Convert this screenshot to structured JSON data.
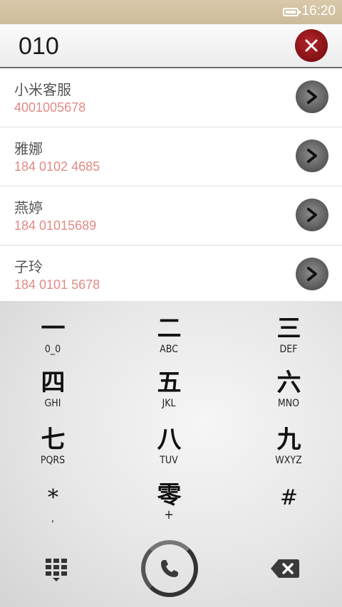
{
  "status_bar": {
    "time": "16:20",
    "battery_icon": "battery-icon"
  },
  "dial_input": {
    "value": "010",
    "clear_icon": "close-icon"
  },
  "results": [
    {
      "name": "小米客服",
      "number": "4001005678"
    },
    {
      "name": "雅娜",
      "number": "184 0102 4685"
    },
    {
      "name": "燕婷",
      "number": "184 01015689"
    },
    {
      "name": "子玲",
      "number": "184 0101 5678"
    }
  ],
  "keypad": {
    "keys": [
      {
        "glyph": "一",
        "letters": "0_0"
      },
      {
        "glyph": "二",
        "letters": "ABC"
      },
      {
        "glyph": "三",
        "letters": "DEF"
      },
      {
        "glyph": "四",
        "letters": "GHI"
      },
      {
        "glyph": "五",
        "letters": "JKL"
      },
      {
        "glyph": "六",
        "letters": "MNO"
      },
      {
        "glyph": "七",
        "letters": "PQRS"
      },
      {
        "glyph": "八",
        "letters": "TUV"
      },
      {
        "glyph": "九",
        "letters": "WXYZ"
      },
      {
        "glyph": "*",
        "letters": ","
      },
      {
        "glyph": "零",
        "letters": "+"
      },
      {
        "glyph": "#",
        "letters": ""
      }
    ]
  },
  "bottom_bar": {
    "left_icon": "dialpad-grid-icon",
    "center_icon": "phone-icon",
    "right_icon": "backspace-icon"
  },
  "colors": {
    "accent_red": "#9e1a1f",
    "number_pink": "#e28a86",
    "status_bar": "#d4c4a4"
  }
}
